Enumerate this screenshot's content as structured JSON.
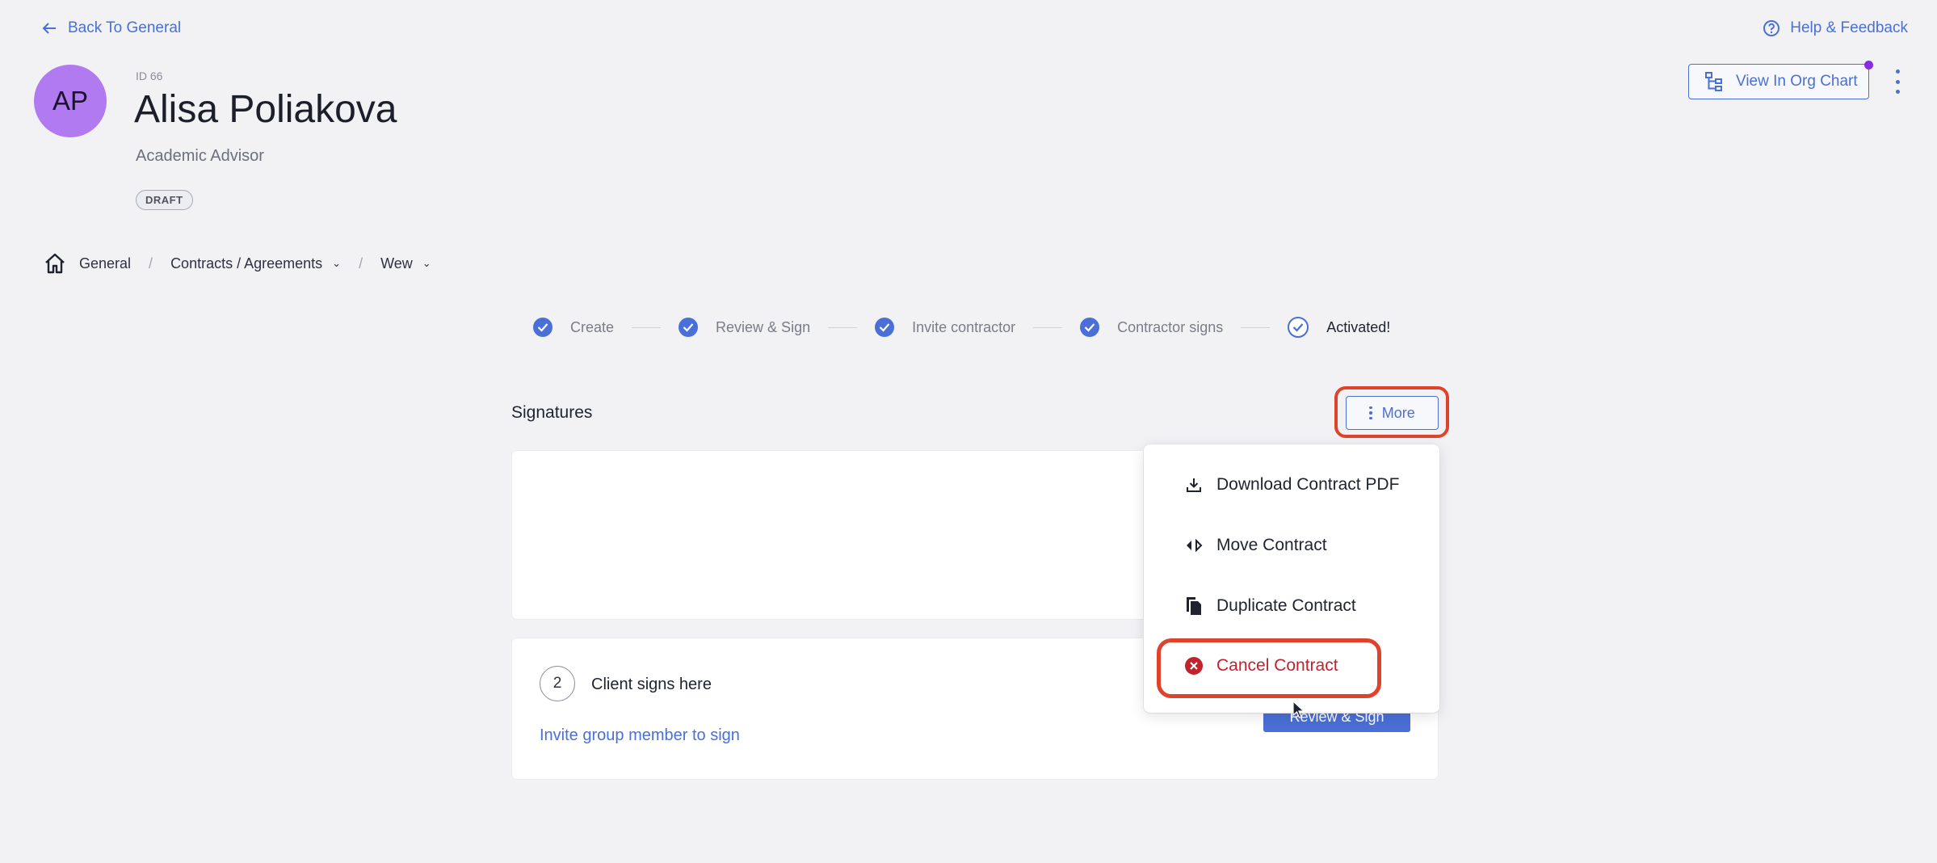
{
  "header": {
    "back_label": "Back To General",
    "help_label": "Help & Feedback",
    "org_chart_label": "View In Org Chart"
  },
  "profile": {
    "initials": "AP",
    "id_text": "ID 66",
    "name": "Alisa Poliakova",
    "role": "Academic Advisor",
    "status": "DRAFT",
    "avatar_color": "#b27af0"
  },
  "breadcrumb": {
    "items": [
      {
        "label": "General",
        "icon": "home-icon"
      },
      {
        "label": "Contracts / Agreements",
        "has_dropdown": true
      },
      {
        "label": "Wew",
        "has_dropdown": true
      }
    ]
  },
  "stepper": {
    "steps": [
      {
        "label": "Create",
        "done": true
      },
      {
        "label": "Review & Sign",
        "done": true
      },
      {
        "label": "Invite contractor",
        "done": true
      },
      {
        "label": "Contractor signs",
        "done": true
      },
      {
        "label": "Activated!",
        "done": true,
        "current": true
      }
    ]
  },
  "signatures": {
    "title": "Signatures",
    "more_label": "More",
    "client_step_number": "2",
    "client_label": "Client signs here",
    "invite_label": "Invite group member to sign",
    "sign_button_label": "Review & Sign"
  },
  "menu": {
    "items": [
      {
        "label": "Download Contract PDF",
        "icon": "download-icon"
      },
      {
        "label": "Move Contract",
        "icon": "move-icon"
      },
      {
        "label": "Duplicate Contract",
        "icon": "duplicate-icon"
      },
      {
        "label": "Cancel Contract",
        "icon": "cancel-icon",
        "danger": true
      }
    ]
  },
  "colors": {
    "accent": "#4a6fd6",
    "danger": "#c0232c",
    "highlight": "#e0432b",
    "background": "#f2f2f5"
  }
}
